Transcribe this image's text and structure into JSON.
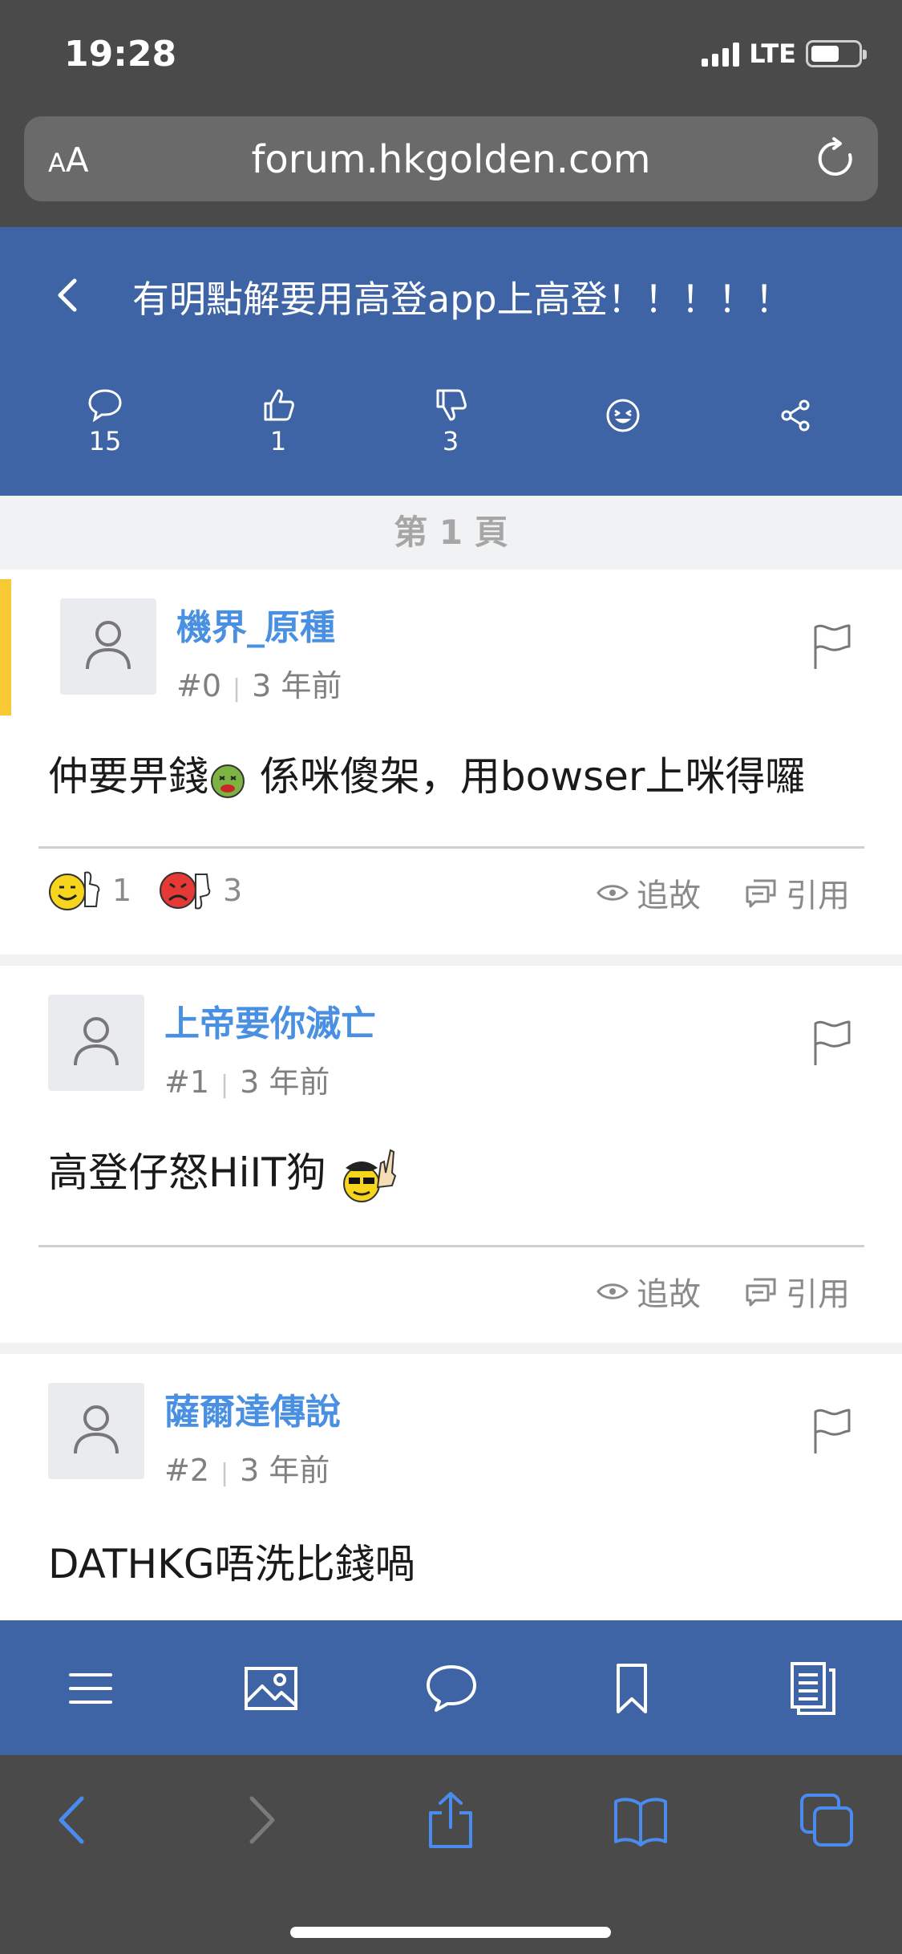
{
  "status_bar": {
    "time": "19:28",
    "network": "LTE"
  },
  "browser": {
    "aa_small": "A",
    "aa_large": "A",
    "url": "forum.hkgolden.com"
  },
  "header": {
    "title": "有明點解要用高登app上高登！！！！！",
    "replies": "15",
    "likes": "1",
    "dislikes": "3"
  },
  "page_indicator": "第 1 頁",
  "posts": [
    {
      "username": "機界_原種",
      "floor": "#0",
      "time": "3 年前",
      "body": "仲要畀錢",
      "body_after_emoji": " 係咪傻架，用bowser上咪得囉",
      "likes": "1",
      "dislikes": "3",
      "follow_label": "追故",
      "quote_label": "引用"
    },
    {
      "username": "上帝要你滅亡",
      "floor": "#1",
      "time": "3 年前",
      "body": "高登仔怒HiIT狗 ",
      "follow_label": "追故",
      "quote_label": "引用"
    },
    {
      "username": "薩爾達傳說",
      "floor": "#2",
      "time": "3 年前",
      "body": "DATHKG唔洗比錢喎"
    }
  ],
  "colors": {
    "app_blue": "#3f64a5",
    "username_blue": "#4a90e2",
    "highlight_yellow": "#f8c935",
    "safari_gray": "#4a4a4a",
    "safari_link_blue": "#4a8bf0"
  }
}
